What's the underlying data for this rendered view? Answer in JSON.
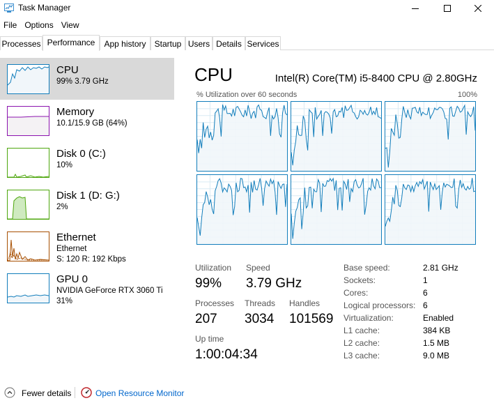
{
  "window": {
    "title": "Task Manager"
  },
  "menu": [
    "File",
    "Options",
    "View"
  ],
  "tabs": [
    "Processes",
    "Performance",
    "App history",
    "Startup",
    "Users",
    "Details",
    "Services"
  ],
  "active_tab": "Performance",
  "sidebar": {
    "items": [
      {
        "title": "CPU",
        "sub1": "99% 3.79 GHz",
        "sub2": "",
        "color": "#117dbb"
      },
      {
        "title": "Memory",
        "sub1": "10.1/15.9 GB (64%)",
        "sub2": "",
        "color": "#8b12ae"
      },
      {
        "title": "Disk 0 (C:)",
        "sub1": "10%",
        "sub2": "",
        "color": "#4da60c"
      },
      {
        "title": "Disk 1 (D: G:)",
        "sub1": "2%",
        "sub2": "",
        "color": "#4da60c"
      },
      {
        "title": "Ethernet",
        "sub1": "Ethernet",
        "sub2": "S: 120  R: 192 Kbps",
        "color": "#a74f01"
      },
      {
        "title": "GPU 0",
        "sub1": "NVIDIA GeForce RTX 3060 Ti",
        "sub2": "31%",
        "color": "#117dbb"
      }
    ]
  },
  "main": {
    "title": "CPU",
    "model": "Intel(R) Core(TM) i5-8400 CPU @ 2.80GHz",
    "util_label": "% Utilization over 60 seconds",
    "util_max": "100%"
  },
  "stats": {
    "utilization_label": "Utilization",
    "utilization_value": "99%",
    "speed_label": "Speed",
    "speed_value": "3.79 GHz",
    "processes_label": "Processes",
    "processes_value": "207",
    "threads_label": "Threads",
    "threads_value": "3034",
    "handles_label": "Handles",
    "handles_value": "101569",
    "uptime_label": "Up time",
    "uptime_value": "1:00:04:34"
  },
  "details": [
    {
      "label": "Base speed:",
      "value": "2.81 GHz"
    },
    {
      "label": "Sockets:",
      "value": "1"
    },
    {
      "label": "Cores:",
      "value": "6"
    },
    {
      "label": "Logical processors:",
      "value": "6"
    },
    {
      "label": "Virtualization:",
      "value": "Enabled"
    },
    {
      "label": "L1 cache:",
      "value": "384 KB"
    },
    {
      "label": "L2 cache:",
      "value": "1.5 MB"
    },
    {
      "label": "L3 cache:",
      "value": "9.0 MB"
    }
  ],
  "bottom": {
    "fewer_details": "Fewer details",
    "open_resource_monitor": "Open Resource Monitor"
  },
  "colors": {
    "cpu_line": "#117dbb",
    "cpu_fill": "#f1f6fa",
    "grid": "#d9eaf4",
    "link": "#0066cc"
  }
}
